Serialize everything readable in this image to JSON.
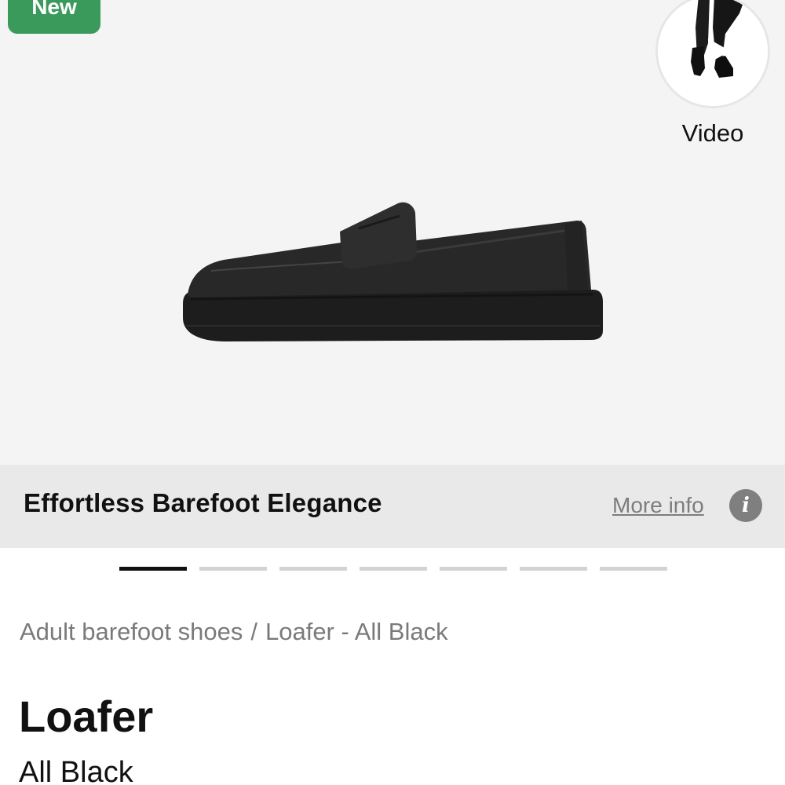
{
  "hero": {
    "badge": "New",
    "video_label": "Video",
    "image_alt": "Loafer All Black side view"
  },
  "info_bar": {
    "title": "Effortless Barefoot Elegance",
    "more_info": "More info",
    "info_icon": "i"
  },
  "pager": {
    "count": 7,
    "active_index": 0
  },
  "breadcrumb": {
    "items": [
      "Adult barefoot shoes",
      "Loafer - All Black"
    ],
    "separator": "/"
  },
  "product": {
    "name": "Loafer",
    "variant": "All Black"
  },
  "colors": {
    "badge_green": "#3a9a5c",
    "hero_bg": "#f4f4f4",
    "info_bar_bg": "#e9e9e9",
    "muted_text": "#7a7a7a",
    "pager_active": "#111111",
    "pager_inactive": "#d3d3d3"
  },
  "icons": {
    "video": "play-icon",
    "info": "info-icon"
  }
}
